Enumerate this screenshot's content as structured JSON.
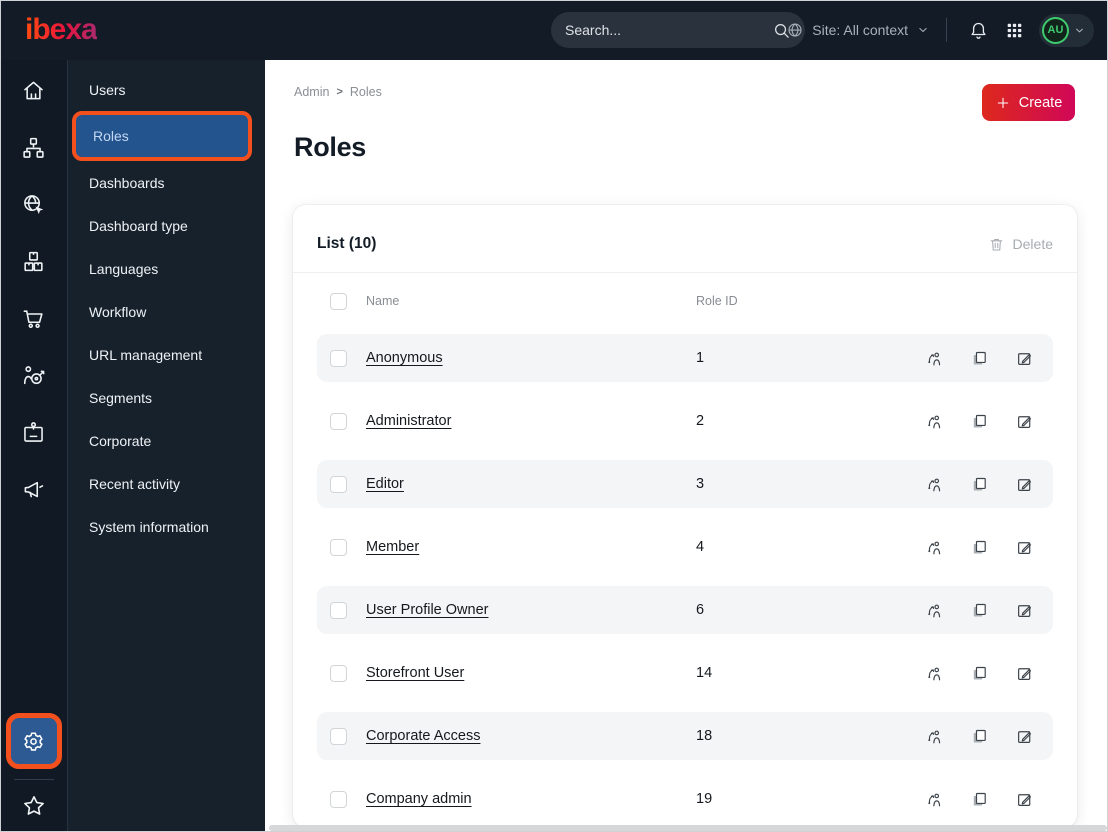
{
  "topbar": {
    "logo": "ibexa",
    "search": {
      "placeholder": "Search..."
    },
    "site_selector": {
      "label": "Site: All context"
    },
    "avatar": {
      "initials": "AU"
    },
    "icons": [
      "globe-icon",
      "chevron-down-icon",
      "bell-icon",
      "grid-icon"
    ]
  },
  "nav_rail": {
    "icons": [
      "home-icon",
      "sitemap-icon",
      "globe-cursor-icon",
      "packages-icon",
      "cart-icon",
      "target-user-icon",
      "badge-icon",
      "megaphone-icon",
      "gear-icon",
      "star-icon"
    ],
    "highlighted": "gear-icon"
  },
  "sidebar": {
    "items": [
      {
        "label": "Users",
        "selected": false
      },
      {
        "label": "Roles",
        "selected": true
      },
      {
        "label": "Dashboards",
        "selected": false
      },
      {
        "label": "Dashboard type",
        "selected": false
      },
      {
        "label": "Languages",
        "selected": false
      },
      {
        "label": "Workflow",
        "selected": false
      },
      {
        "label": "URL management",
        "selected": false
      },
      {
        "label": "Segments",
        "selected": false
      },
      {
        "label": "Corporate",
        "selected": false
      },
      {
        "label": "Recent activity",
        "selected": false
      },
      {
        "label": "System information",
        "selected": false
      }
    ]
  },
  "breadcrumb": {
    "items": [
      "Admin",
      "Roles"
    ],
    "separator": ">"
  },
  "page": {
    "title": "Roles"
  },
  "actions": {
    "create_label": "Create"
  },
  "list": {
    "title": "List (10)",
    "delete_label": "Delete",
    "columns": {
      "name": "Name",
      "role_id": "Role ID"
    },
    "row_actions": [
      "assign-user-icon",
      "copy-icon",
      "edit-icon"
    ],
    "rows": [
      {
        "name": "Anonymous",
        "role_id": "1"
      },
      {
        "name": "Administrator",
        "role_id": "2"
      },
      {
        "name": "Editor",
        "role_id": "3"
      },
      {
        "name": "Member",
        "role_id": "4"
      },
      {
        "name": "User Profile Owner",
        "role_id": "6"
      },
      {
        "name": "Storefront User",
        "role_id": "14"
      },
      {
        "name": "Corporate Access",
        "role_id": "18"
      },
      {
        "name": "Company admin",
        "role_id": "19"
      }
    ]
  },
  "colors": {
    "topbar_bg": "#131b26",
    "highlight_orange": "#f4501e",
    "selected_blue": "#24548e",
    "create_gradient": [
      "#dc291c",
      "#d00758"
    ],
    "avatar_green": "#3ecb6e"
  }
}
